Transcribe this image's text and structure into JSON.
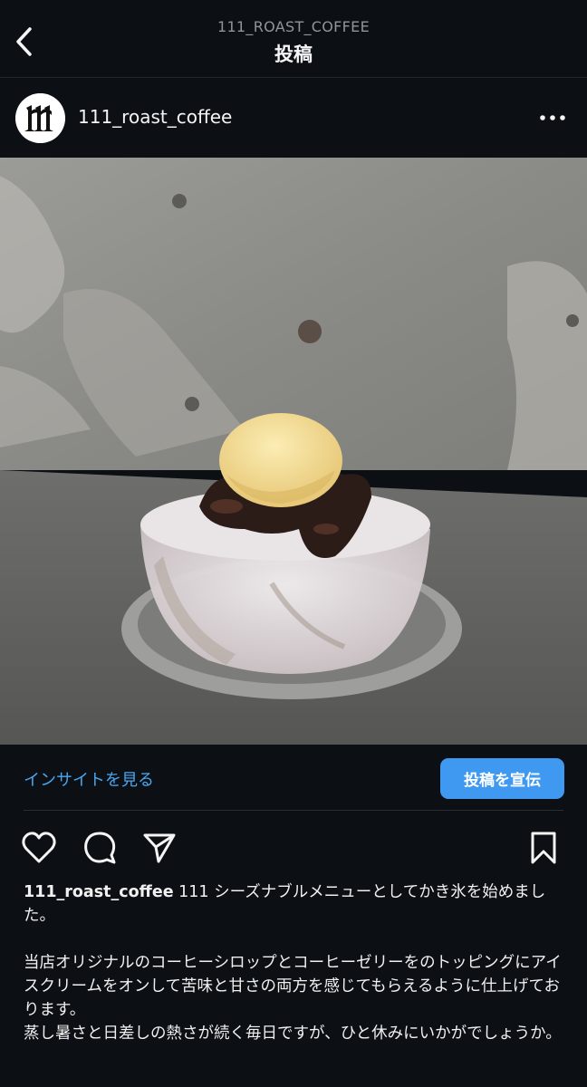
{
  "header": {
    "subtitle": "111_ROAST_COFFEE",
    "title": "投稿"
  },
  "post": {
    "username": "111_roast_coffee",
    "image_alt": "かき氷 (coffee shaved ice with coffee jelly and ice cream)"
  },
  "insights": {
    "link_label": "インサイトを見る",
    "promote_label": "投稿を宣伝"
  },
  "caption": {
    "username": "111_roast_coffee",
    "line1": " 111 シーズナブルメニューとしてかき氷を始めました。",
    "paragraph2": "当店オリジナルのコーヒーシロップとコーヒーゼリーをのトッピングにアイスクリームをオンして苦味と甘さの両方を感じてもらえるように仕上げております。",
    "paragraph3": "蒸し暑さと日差しの熱さが続く毎日ですが、ひと休みにいかがでしょうか。"
  },
  "colors": {
    "background": "#0c1014",
    "accent_link": "#4aa6f0",
    "promote_button": "#3f99f0"
  },
  "icons": [
    "back-chevron-icon",
    "more-options-icon",
    "heart-icon",
    "comment-icon",
    "share-icon",
    "bookmark-icon"
  ]
}
